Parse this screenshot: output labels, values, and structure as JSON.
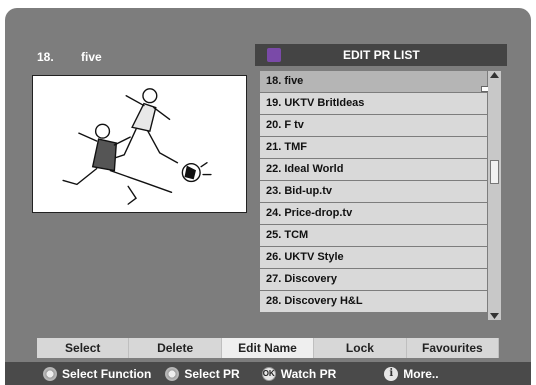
{
  "current": {
    "number": "18.",
    "name": "five"
  },
  "panel": {
    "title": "EDIT PR LIST",
    "icon": "edit-list-icon"
  },
  "channels": [
    "18. five",
    "19. UKTV BritIdeas",
    "20. F tv",
    "21. TMF",
    "22. Ideal World",
    "23. Bid-up.tv",
    "24. Price-drop.tv",
    "25. TCM",
    "26. UKTV Style",
    "27. Discovery",
    "28. Discovery H&L"
  ],
  "selected_index": 0,
  "functions": [
    "Select",
    "Delete",
    "Edit Name",
    "Lock",
    "Favourites"
  ],
  "active_function": "Edit Name",
  "help": [
    {
      "icon": "gear-icon",
      "label": "Select Function"
    },
    {
      "icon": "gear-icon",
      "label": "Select PR"
    },
    {
      "icon": "ok-icon",
      "glyph": "OK",
      "label": "Watch PR"
    },
    {
      "icon": "info-icon",
      "glyph": "i",
      "label": "More.."
    }
  ],
  "colors": {
    "background": "#7d7d7d",
    "list_row": "#d9d9d9",
    "header": "#444444",
    "help_bar": "#4a4a4a"
  }
}
